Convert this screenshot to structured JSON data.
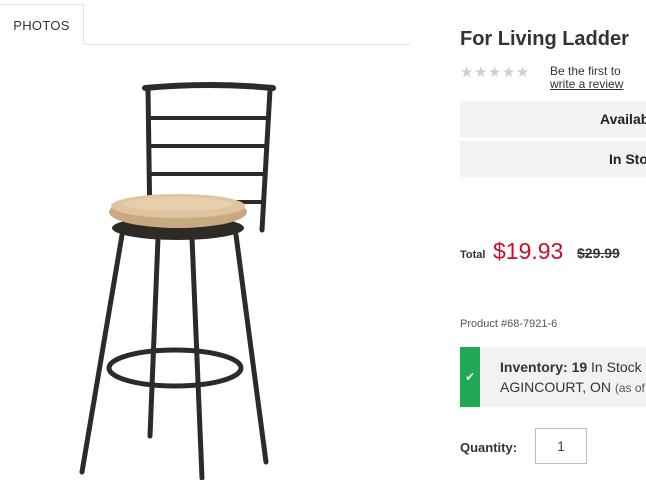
{
  "tabs": {
    "photos": "PHOTOS"
  },
  "product": {
    "title": "For Living Ladder",
    "rating": {
      "stars": 0,
      "max": 5,
      "review_line1": "Be the first to",
      "review_link": "write a review"
    },
    "availability_bar": "Availab",
    "stock_bar": "In Stoc",
    "total_label": "Total",
    "price": "$19.93",
    "old_price": "$29.99",
    "product_number": "Product #68-7921-6",
    "inventory": {
      "label": "Inventory:",
      "count": "19",
      "status": "In Stock",
      "location": "AGINCOURT, ON",
      "as_of": "(as of"
    },
    "quantity_label": "Quantity:",
    "quantity_value": "1"
  },
  "colors": {
    "price": "#c8102e",
    "in_stock_check": "#1fa855",
    "stars_empty": "#cfcfcf"
  },
  "icons": {
    "check": "check-icon",
    "star": "star-icon"
  }
}
